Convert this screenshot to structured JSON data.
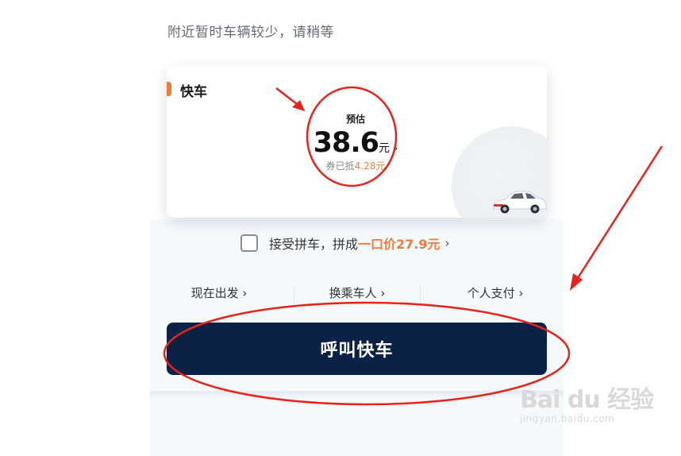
{
  "notice_text": "附近暂时车辆较少，请稍等",
  "card": {
    "title": "快车",
    "price_caption": "预估",
    "price_value": "38.6",
    "price_unit": "元",
    "price_arrow": "›",
    "coupon_prefix": "券已抵",
    "coupon_amount": "4.28元"
  },
  "carpool": {
    "label": "接受拼车，拼成",
    "price": "一口价27.9元",
    "arrow": "›"
  },
  "options": [
    {
      "label": "现在出发 ›"
    },
    {
      "label": "换乘车人 ›"
    },
    {
      "label": "个人支付 ›"
    }
  ],
  "call_button": "呼叫快车",
  "watermark": {
    "logo": "Bai du 经验",
    "sub": "jingyan.baidu.com"
  },
  "colors": {
    "accent_orange": "#f07b3c",
    "button_navy": "#0b2246",
    "annotation_red": "#e8231c"
  },
  "icons": [
    "car-icon",
    "checkbox-icon",
    "chevron-right-icon"
  ]
}
